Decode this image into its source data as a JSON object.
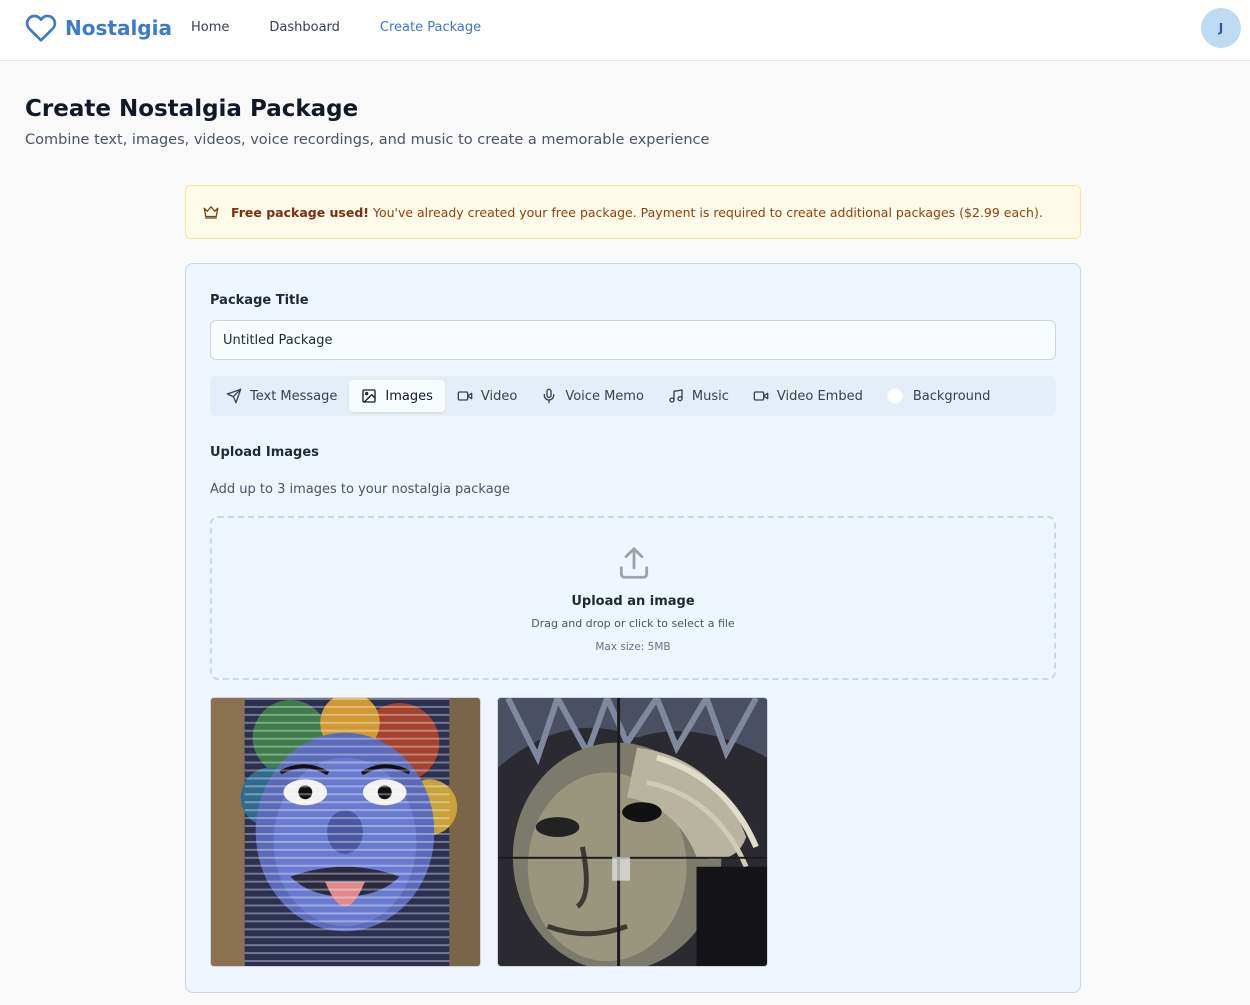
{
  "header": {
    "brand": "Nostalgia",
    "nav": [
      {
        "label": "Home"
      },
      {
        "label": "Dashboard"
      },
      {
        "label": "Create Package"
      }
    ],
    "avatar_initial": "J",
    "brand_color": "#3b7bc7"
  },
  "page": {
    "title": "Create Nostalgia Package",
    "subtitle": "Combine text, images, videos, voice recordings, and music to create a memorable experience"
  },
  "alert": {
    "icon": "crown-icon",
    "bold": "Free package used!",
    "text": " You've already created your free package. Payment is required to create additional packages ($2.99 each)."
  },
  "form": {
    "title_label": "Package Title",
    "title_value": "Untitled Package",
    "tabs": [
      {
        "label": "Text Message",
        "icon": "send-icon"
      },
      {
        "label": "Images",
        "icon": "image-icon",
        "active": true
      },
      {
        "label": "Video",
        "icon": "video-icon"
      },
      {
        "label": "Voice Memo",
        "icon": "mic-icon"
      },
      {
        "label": "Music",
        "icon": "music-icon"
      },
      {
        "label": "Video Embed",
        "icon": "video-icon"
      },
      {
        "label": "Background",
        "icon": "color-swatch"
      }
    ],
    "upload": {
      "title": "Upload Images",
      "description": "Add up to 3 images to your nostalgia package",
      "dropzone_title": "Upload an image",
      "dropzone_sub": "Drag and drop or click to select a file",
      "max_size": "Max size: 5MB"
    }
  }
}
